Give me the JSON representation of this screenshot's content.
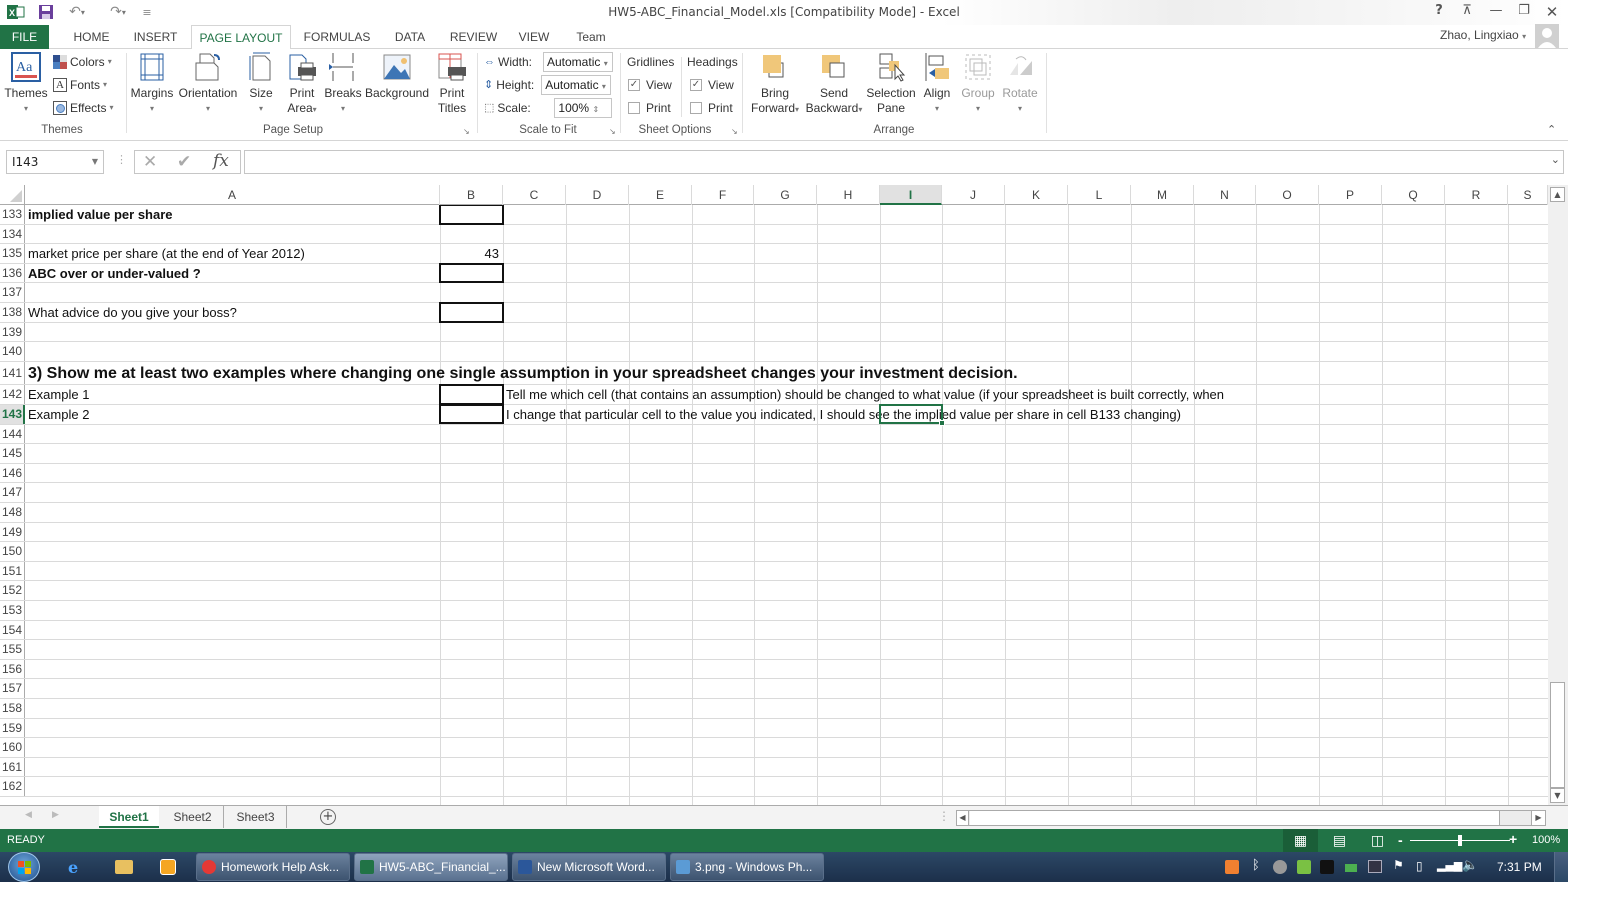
{
  "window": {
    "title": "HW5-ABC_Financial_Model.xls  [Compatibility Mode] - Excel",
    "help": "?",
    "user": "Zhao, Lingxiao"
  },
  "quick_access": {
    "undo_icon": "undo-icon",
    "redo_icon": "redo-icon",
    "save_icon": "save-icon",
    "customize": "≡"
  },
  "ribbon_tabs": [
    "FILE",
    "HOME",
    "INSERT",
    "PAGE LAYOUT",
    "FORMULAS",
    "DATA",
    "REVIEW",
    "VIEW",
    "Team"
  ],
  "active_tab": "PAGE LAYOUT",
  "ribbon": {
    "themes": {
      "label": "Themes",
      "themes_btn": "Themes",
      "colors": "Colors",
      "fonts": "Fonts",
      "effects": "Effects"
    },
    "page_setup": {
      "label": "Page Setup",
      "margins": "Margins",
      "orientation": "Orientation",
      "size": "Size",
      "print_area_1": "Print",
      "print_area_2": "Area",
      "breaks": "Breaks",
      "background": "Background",
      "print_titles_1": "Print",
      "print_titles_2": "Titles"
    },
    "scale_to_fit": {
      "label": "Scale to Fit",
      "width_label": "Width:",
      "width_value": "Automatic",
      "height_label": "Height:",
      "height_value": "Automatic",
      "scale_label": "Scale:",
      "scale_value": "100%"
    },
    "sheet_options": {
      "label": "Sheet Options",
      "gridlines": "Gridlines",
      "headings": "Headings",
      "view": "View",
      "print": "Print",
      "gridlines_view": true,
      "gridlines_print": false,
      "headings_view": true,
      "headings_print": false
    },
    "arrange": {
      "label": "Arrange",
      "bring_forward_1": "Bring",
      "bring_forward_2": "Forward",
      "send_backward_1": "Send",
      "send_backward_2": "Backward",
      "selection_pane_1": "Selection",
      "selection_pane_2": "Pane",
      "align": "Align",
      "group": "Group",
      "rotate": "Rotate"
    }
  },
  "formula_bar": {
    "name_box": "I143",
    "formula": "",
    "fx": "fx"
  },
  "columns": [
    "A",
    "B",
    "C",
    "D",
    "E",
    "F",
    "G",
    "H",
    "I",
    "J",
    "K",
    "L",
    "M",
    "N",
    "O",
    "P",
    "Q",
    "R",
    "S"
  ],
  "selected_column": "I",
  "selected_row": "143",
  "rows": [
    {
      "n": "133",
      "a": "implied value per share",
      "a_bold": true,
      "b": "",
      "b_boxed": true
    },
    {
      "n": "134",
      "a": ""
    },
    {
      "n": "135",
      "a": "market price per share (at the end of Year 2012)",
      "b": "43"
    },
    {
      "n": "136",
      "a": "ABC over or under-valued ?",
      "a_bold": true,
      "b_boxed": true
    },
    {
      "n": "137",
      "a": ""
    },
    {
      "n": "138",
      "a": "What advice do you give your boss?",
      "b_boxed": true
    },
    {
      "n": "139",
      "a": ""
    },
    {
      "n": "140",
      "a": ""
    },
    {
      "n": "141",
      "a": "3) Show me at least two examples where changing one single assumption in your spreadsheet changes your investment decision.",
      "a_bold": true,
      "large": true
    },
    {
      "n": "142",
      "a": "Example 1",
      "b_boxed": true,
      "c": "Tell me which cell (that contains an assumption) should be changed to what value (if your spreadsheet is built correctly, when"
    },
    {
      "n": "143",
      "a": "Example 2",
      "b_boxed": true,
      "c": " I change that particular cell to the value you indicated, I should see the implied value per share in cell B133 changing)"
    },
    {
      "n": "144"
    },
    {
      "n": "145"
    },
    {
      "n": "146"
    },
    {
      "n": "147"
    },
    {
      "n": "148"
    },
    {
      "n": "149"
    },
    {
      "n": "150"
    },
    {
      "n": "151"
    },
    {
      "n": "152"
    },
    {
      "n": "153"
    },
    {
      "n": "154"
    },
    {
      "n": "155"
    },
    {
      "n": "156"
    },
    {
      "n": "157"
    },
    {
      "n": "158"
    },
    {
      "n": "159"
    },
    {
      "n": "160"
    },
    {
      "n": "161"
    },
    {
      "n": "162"
    }
  ],
  "sheet_tabs": [
    "Sheet1",
    "Sheet2",
    "Sheet3"
  ],
  "active_sheet": "Sheet1",
  "status": {
    "mode": "READY",
    "zoom": "100%",
    "zoom_fraction": 0.5
  },
  "taskbar": {
    "items": [
      {
        "label": "Homework Help Ask...",
        "icon": "chrome-icon"
      },
      {
        "label": "HW5-ABC_Financial_...",
        "icon": "excel-icon",
        "active": true
      },
      {
        "label": "New Microsoft Word...",
        "icon": "word-icon"
      },
      {
        "label": "3.png - Windows Ph...",
        "icon": "photo-viewer-icon"
      }
    ],
    "clock": "7:31 PM"
  },
  "colors": {
    "excel_green": "#217346",
    "selection_green": "#217346"
  }
}
